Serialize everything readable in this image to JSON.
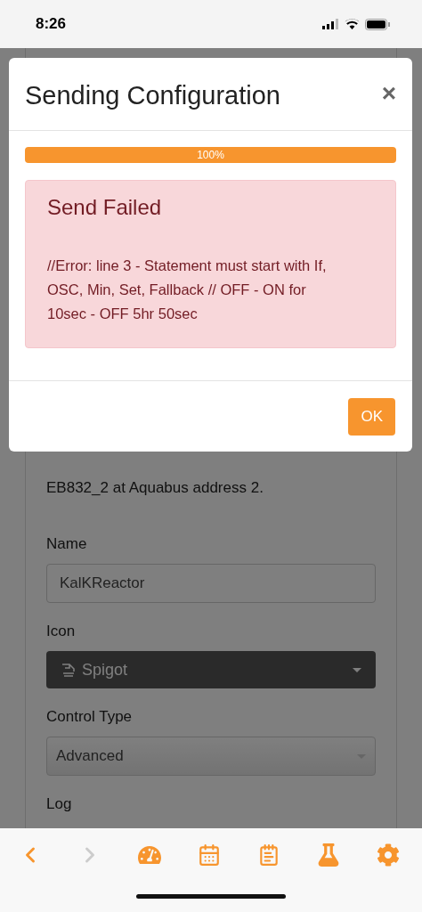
{
  "status_bar": {
    "time": "8:26"
  },
  "modal": {
    "title": "Sending Configuration",
    "close": "×",
    "progress": {
      "level": 1,
      "label": "100%"
    },
    "alert": {
      "title": "Send Failed",
      "message": "//Error: line 3 - Statement must start with If, OSC, Min, Set, Fallback // OFF - ON for 10sec - OFF 5hr 50sec"
    },
    "ok_button": "OK"
  },
  "background_form": {
    "description": "EB832_2 at Aquabus address 2.",
    "fields": [
      {
        "kind": "text",
        "label": "Name",
        "value": "KalKReactor"
      },
      {
        "kind": "icon_select",
        "label": "Icon",
        "value": "Spigot"
      },
      {
        "kind": "select",
        "label": "Control Type",
        "value": "Advanced"
      },
      {
        "kind": "label_only",
        "label": "Log"
      }
    ]
  },
  "nav": [
    {
      "kind": "back",
      "disabled": false
    },
    {
      "kind": "forward",
      "disabled": true
    },
    {
      "kind": "dashboard",
      "disabled": false
    },
    {
      "kind": "calendar",
      "disabled": false
    },
    {
      "kind": "notes",
      "disabled": false
    },
    {
      "kind": "lab",
      "disabled": false
    },
    {
      "kind": "settings",
      "disabled": false
    }
  ]
}
